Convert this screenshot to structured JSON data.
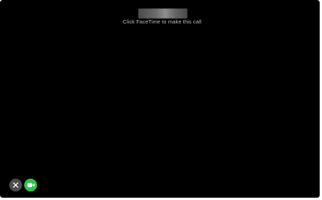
{
  "call": {
    "contact_name": "",
    "status_text": "Click FaceTime to make this call"
  },
  "controls": {
    "cancel_icon": "close-icon",
    "facetime_icon": "video-camera-icon"
  },
  "colors": {
    "background": "#000000",
    "status_text": "#bdbdbd",
    "cancel_button": "#4b4b4b",
    "facetime_button": "#2fc24b"
  }
}
